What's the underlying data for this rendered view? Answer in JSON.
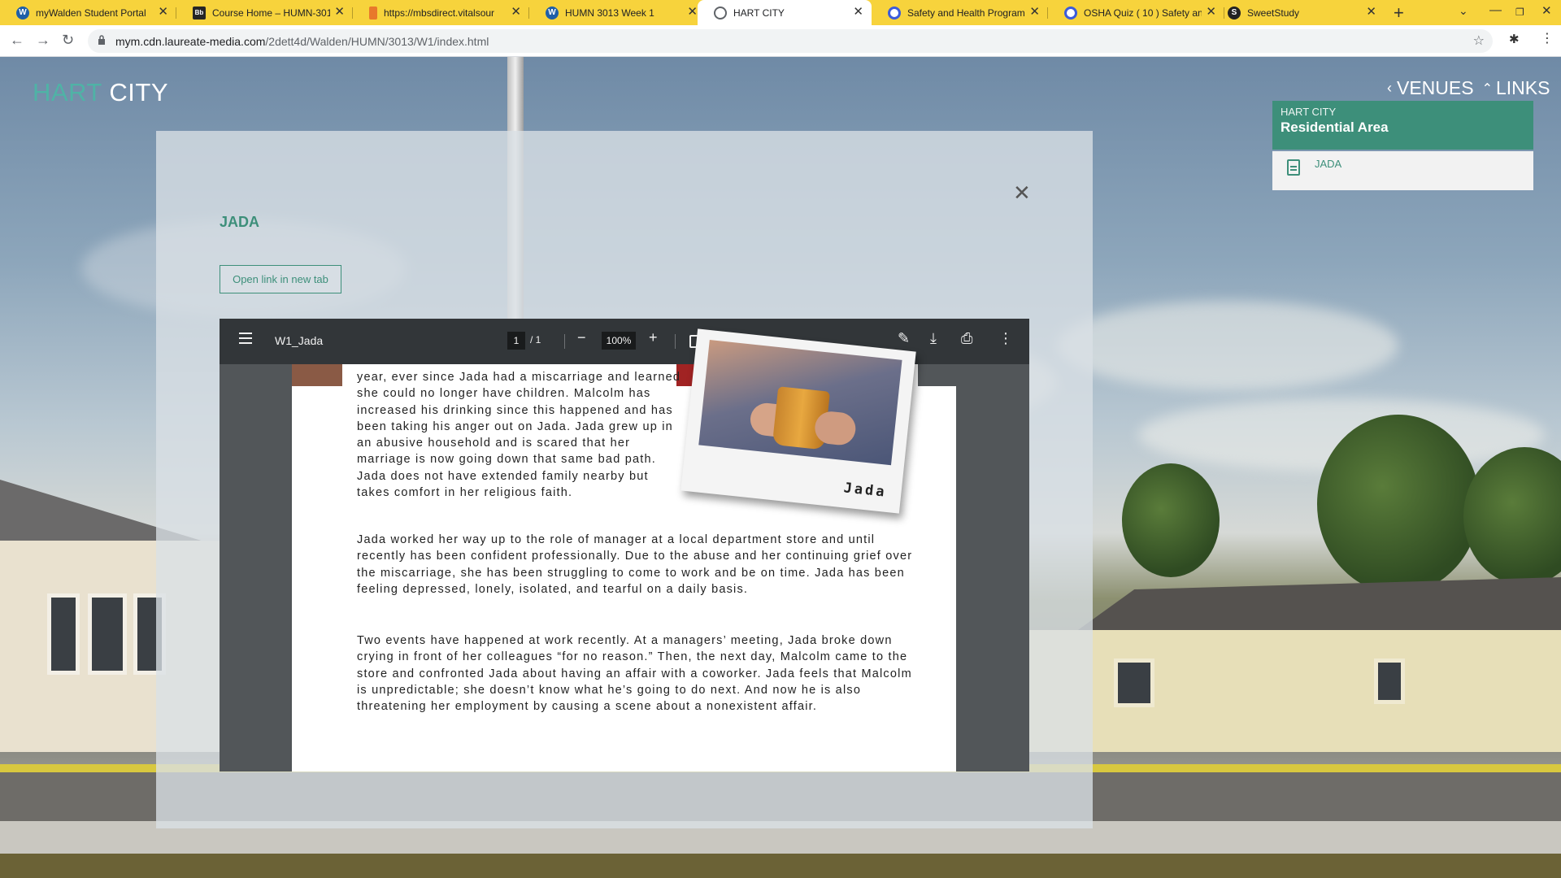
{
  "browser": {
    "tabs": [
      {
        "title": "myWalden Student Portal",
        "favicon": "W",
        "favicon_color": "#1f5fa8"
      },
      {
        "title": "Course Home – HUMN-301",
        "favicon": "Bb",
        "favicon_color": "#262626"
      },
      {
        "title": "https://mbsdirect.vitalsour",
        "favicon": "▮",
        "favicon_color": "#e8792b"
      },
      {
        "title": "HUMN 3013 Week 1",
        "favicon": "W",
        "favicon_color": "#1f5fa8"
      },
      {
        "title": "HART CITY",
        "favicon": "⊕",
        "favicon_color": "#5f6368"
      },
      {
        "title": "Safety and Health Program",
        "favicon": "Q",
        "favicon_color": "#3b5bdb"
      },
      {
        "title": "OSHA Quiz ( 10 ) Safety an",
        "favicon": "Q",
        "favicon_color": "#3b5bdb"
      },
      {
        "title": "SweetStudy",
        "favicon": "S",
        "favicon_color": "#222222"
      }
    ],
    "url_host": "mym.cdn.laureate-media.com",
    "url_path": "/2dett4d/Walden/HUMN/3013/W1/index.html"
  },
  "site": {
    "brand_first": "HART",
    "brand_second": "CITY",
    "nav_venues": "VENUES",
    "nav_links": "LINKS",
    "panel_sub": "HART CITY",
    "panel_title": "Residential Area",
    "panel_item": "JADA"
  },
  "modal": {
    "title": "JADA",
    "open_link": "Open link in new tab"
  },
  "pdf": {
    "filename": "W1_Jada",
    "page_current": "1",
    "page_total": "/ 1",
    "zoom": "100%",
    "photo_caption": "Jada",
    "para1": "year, ever since Jada had a miscarriage and learned she could no longer have children. Malcolm has increased his drinking since this happened and has been taking his anger out on Jada. Jada grew up in an abusive household and is scared that her marriage is now going down that same bad path. Jada does not have extended family nearby but takes comfort in her religious faith.",
    "para2": "Jada worked her way up to the role of manager at a local department store and until recently has been confident professionally. Due to the abuse and her continuing grief over the miscarriage, she has been struggling to come to work and be on time. Jada has been feeling depressed, lonely, isolated, and tearful on a daily basis.",
    "para3": "Two events have happened at work recently. At a managers’ meeting, Jada broke down crying in front of her colleagues “for no reason.” Then, the next day, Malcolm came to the store and confronted Jada about having an affair with a coworker. Jada feels that Malcolm is unpredictable; she doesn’t know what he’s going to do next. And now he is also threatening her employment by causing a scene about a nonexistent affair."
  },
  "colors": {
    "tabstrip": "#f7d33c",
    "accent": "#3d8f7a",
    "brand_teal": "#4fb3a6",
    "pdf_toolbar": "#323639"
  }
}
